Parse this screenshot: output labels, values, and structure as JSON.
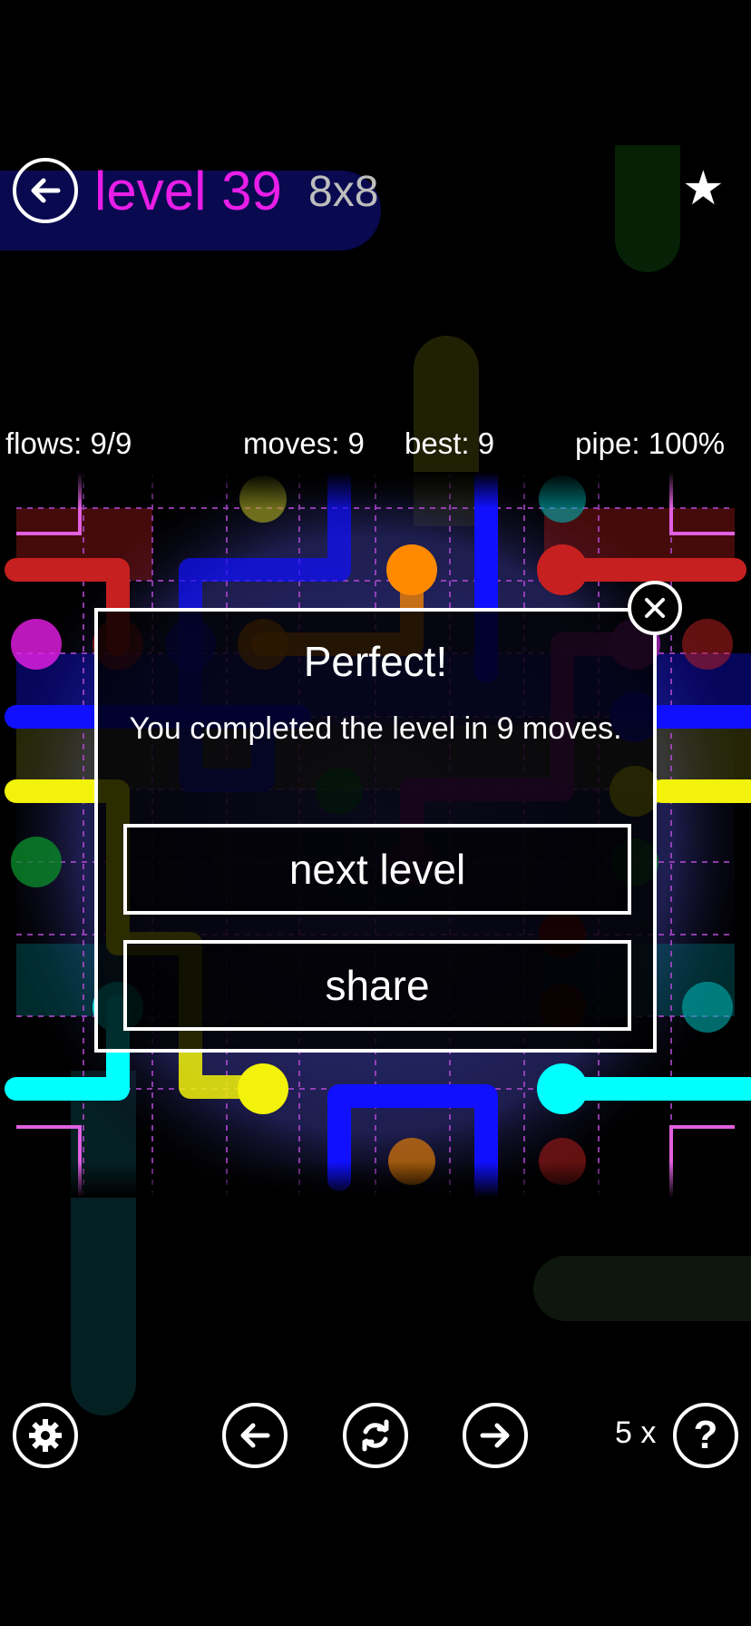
{
  "header": {
    "level_label": "level 39",
    "size_label": "8x8",
    "back_icon": "arrow-left-icon",
    "star_icon": "star-icon",
    "star_glyph": "★"
  },
  "stats": {
    "flows": "flows: 9/9",
    "moves": "moves: 9",
    "best": "best: 9",
    "pipe": "pipe: 100%"
  },
  "modal": {
    "title": "Perfect!",
    "message": "You completed the level in 9 moves.",
    "next_label": "next level",
    "share_label": "share",
    "close_icon": "close-icon"
  },
  "toolbar": {
    "settings_icon": "gear-icon",
    "prev_icon": "arrow-left-icon",
    "restart_icon": "refresh-icon",
    "next_icon": "arrow-right-icon",
    "hints_count": "5 x",
    "hint_icon": "question-icon",
    "hint_glyph": "?"
  },
  "colors": {
    "title": "#e81ee8",
    "red": "#c62020",
    "blue": "#1010ff",
    "yellow": "#f2f20a",
    "cyan": "#00ffff",
    "orange": "#ff8a00",
    "purple": "#8a1f9a",
    "green": "#0a8a2a",
    "magenta": "#e81ee8",
    "maroon": "#8a0000"
  }
}
